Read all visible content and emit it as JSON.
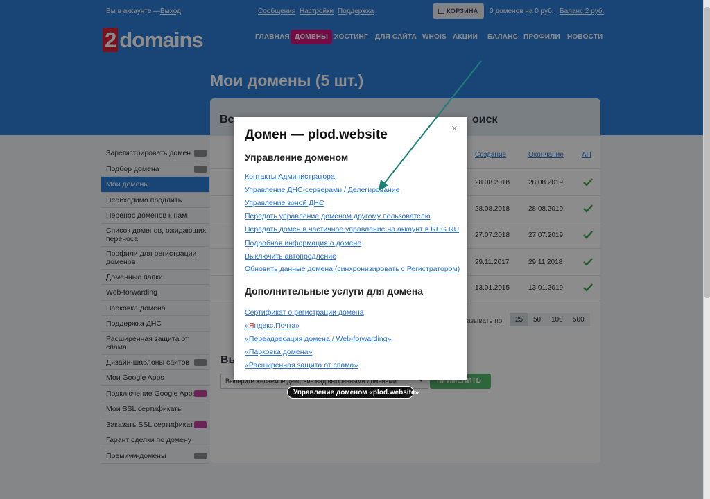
{
  "topbar": {
    "logged_in_text": "Вы в аккаунте —",
    "logout": "Выход",
    "messages": "Сообщения",
    "settings": "Настройки",
    "support": "Поддержка",
    "cart": "КОРЗИНА",
    "cart_summary": "0 доменов на 0 руб.",
    "balance": "Баланс 2 руб."
  },
  "logo": {
    "prefix": "2",
    "name": "domains"
  },
  "nav": [
    "ГЛАВНАЯ",
    "ДОМЕНЫ",
    "ХОСТИНГ",
    "ДЛЯ САЙТА",
    "WHOIS",
    "АКЦИИ",
    "БАЛАНС",
    "ПРОФИЛИ",
    "НОВОСТИ"
  ],
  "page_title": "Мои домены (5 шт.)",
  "sidebar": [
    {
      "label": "Зарегистрировать домен",
      "tag": "gray"
    },
    {
      "label": "Подбор домена",
      "tag": "gray"
    },
    {
      "label": "Мои домены",
      "active": true
    },
    {
      "label": "Необходимо продлить"
    },
    {
      "label": "Перенос доменов к нам"
    },
    {
      "label": "Список доменов, ожидающих переноса",
      "two_line": true
    },
    {
      "label": "Профили для регистрации доменов",
      "two_line": true
    },
    {
      "label": "Доменные папки"
    },
    {
      "label": "Web-forwarding"
    },
    {
      "label": "Парковка домена"
    },
    {
      "label": "Поддержка ДНС"
    },
    {
      "label": "Расширенная защита от спама",
      "two_line": true
    },
    {
      "label": "Дизайн-шаблоны сайтов",
      "tag": "gray"
    },
    {
      "label": "Мои Google Apps"
    },
    {
      "label": "Подключение Google Apps",
      "tag": "pink"
    },
    {
      "label": "Мои SSL сертификаты"
    },
    {
      "label": "Заказать SSL сертификат",
      "tag": "pink"
    },
    {
      "label": "Гарант сделки по домену"
    },
    {
      "label": "Премиум-домены",
      "tag": "gray"
    }
  ],
  "card": {
    "head_left": "Вс",
    "head_right": "оиск",
    "columns": {
      "created": "Создание",
      "expires": "Окончание",
      "autorenew": "АП"
    },
    "rows": [
      {
        "created": "28.08.2018",
        "expires": "28.08.2019"
      },
      {
        "created": "28.08.2018",
        "expires": "28.08.2019"
      },
      {
        "created": "27.07.2018",
        "expires": "27.07.2019"
      },
      {
        "created": "29.11.2017",
        "expires": "29.11.2018"
      },
      {
        "created": "13.01.2015",
        "expires": "13.01.2019"
      }
    ],
    "page_size_label": "азывать по:",
    "page_sizes": [
      "25",
      "50",
      "100",
      "500"
    ],
    "action_title": "Вы",
    "action_select": "Выберите желаемое действие над выбранными доменами",
    "apply": "ПРИМЕНИТЬ"
  },
  "modal": {
    "title": "Домен — plod.website",
    "close": "×",
    "section1": "Управление доменом",
    "links1": [
      "Контакты Администратора",
      "Управление ДНС-серверами / Делегирование",
      "Управление зоной ДНС",
      "Передать управление доменом другому пользователю",
      "Передать домен в частичное управление на аккаунт в REG.RU",
      "Подробная информация о домене",
      "Выключить автопродление",
      "Обновить данные домена (синхронизировать с Регистратором)"
    ],
    "section2": "Дополнительные услуги для домена",
    "links2": [
      "Сертификат о регистрации домена",
      "«Яндекс.Почта»",
      "«Переадресация домена / Web-forwarding»",
      "«Парковка домена»",
      "«Расширенная защита от спама»"
    ]
  },
  "tooltip": "Управление доменом «plod.website»",
  "colors": {
    "brand_blue": "#2f7ed8",
    "active_nav": "#d2157f",
    "link": "#2770d0",
    "arrow": "#1a7f74",
    "check": "#3aa64c"
  }
}
